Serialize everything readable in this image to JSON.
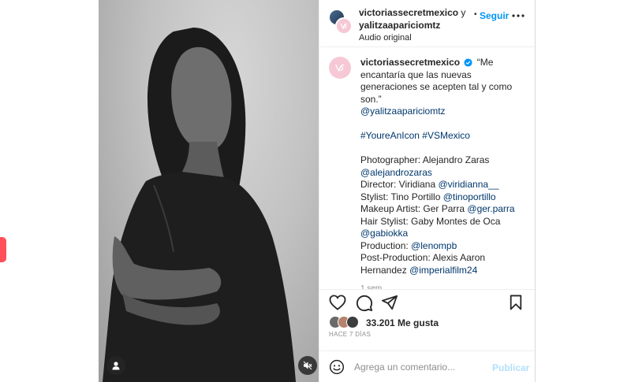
{
  "header": {
    "author_primary": "victoriassecretmexico",
    "joiner": " y",
    "author_secondary": "yalitzaapariciomtz",
    "audio": "Audio original",
    "dot": "•",
    "follow": "Seguir"
  },
  "caption": {
    "username": "victoriassecretmexico",
    "quote": "“Me encantaría que las nuevas generaciones se acepten tal y como son.”",
    "mention": "@yalitzaapariciomtz",
    "hashtags": "#YoureAnIcon #VSMexico",
    "credits": [
      {
        "label": "Photographer: Alejandro Zaras",
        "handle": "@alejandrozaras"
      },
      {
        "label": "Director: Viridiana",
        "handle": "@viridianna__"
      },
      {
        "label": "Stylist: Tino Portillo",
        "handle": "@tinoportillo"
      },
      {
        "label": "Makeup Artist: Ger Parra",
        "handle": "@ger.parra"
      },
      {
        "label": "Hair Stylist: Gaby Montes de Oca",
        "handle": "@gabiokka"
      },
      {
        "label": "Production:",
        "handle": "@lenompb"
      },
      {
        "label": "Post-Production: Alexis Aaron Hernandez",
        "handle": "@imperialfilm24"
      }
    ],
    "time": "1 sem"
  },
  "actions": {
    "likes": "33.201 Me gusta",
    "ago": "HACE 7 DÍAS"
  },
  "comment": {
    "placeholder": "Agrega un comentario...",
    "publish": "Publicar"
  },
  "colors": {
    "accent": "#0095f6",
    "publish_disabled": "#b2dffc",
    "link": "#00376b",
    "side_tab": "#ff4f5a",
    "brand_avatar": "#f6c8d6"
  },
  "icons": [
    "user-tag-icon",
    "mute-icon",
    "more-icon",
    "verified-icon",
    "heart-icon",
    "comment-icon",
    "share-icon",
    "save-icon",
    "emoji-icon"
  ]
}
